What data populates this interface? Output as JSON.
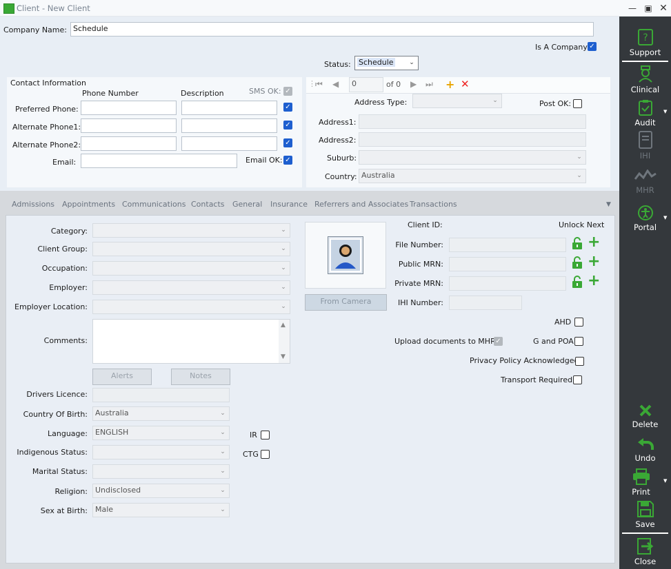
{
  "window": {
    "title": "Client - New Client"
  },
  "header": {
    "company_name_label": "Company Name:",
    "company_name_value": "Schedule",
    "is_company_label": "Is A Company:",
    "status_label": "Status:",
    "status_value": "Schedule"
  },
  "contact": {
    "section_title": "Contact Information",
    "col_phone": "Phone Number",
    "col_description": "Description",
    "sms_ok_label": "SMS OK:",
    "rows": [
      {
        "label": "Preferred Phone:",
        "phone": "",
        "description": ""
      },
      {
        "label": "Alternate Phone1:",
        "phone": "",
        "description": ""
      },
      {
        "label": "Alternate Phone2:",
        "phone": "",
        "description": ""
      }
    ],
    "email_label": "Email:",
    "email_value": "",
    "email_ok_label": "Email OK:"
  },
  "address": {
    "record_value": "0",
    "of_label": "of 0",
    "address_type_label": "Address  Type:",
    "post_ok_label": "Post OK:",
    "address1_label": "Address1:",
    "address2_label": "Address2:",
    "suburb_label": "Suburb:",
    "country_label": "Country:",
    "country_value": "Australia"
  },
  "tabs": [
    "Admissions",
    "Appointments",
    "Communications",
    "Contacts",
    "General",
    "Insurance",
    "Referrers and Associates",
    "Transactions"
  ],
  "general": {
    "category_label": "Category:",
    "client_group_label": "Client Group:",
    "occupation_label": "Occupation:",
    "employer_label": "Employer:",
    "employer_location_label": "Employer Location:",
    "comments_label": "Comments:",
    "alerts_button": "Alerts",
    "notes_button": "Notes",
    "drivers_licence_label": "Drivers Licence:",
    "country_of_birth_label": "Country Of Birth:",
    "country_of_birth_value": "Australia",
    "language_label": "Language:",
    "language_value": "ENGLISH",
    "indigenous_label": "Indigenous Status:",
    "marital_label": "Marital Status:",
    "religion_label": "Religion:",
    "religion_value": "Undisclosed",
    "sex_label": "Sex at Birth:",
    "sex_value": "Male",
    "ir_label": "IR",
    "ctg_label": "CTG",
    "from_camera_button": "From Camera",
    "client_id_label": "Client ID:",
    "unlock_next_label": "Unlock Next",
    "file_number_label": "File Number:",
    "public_mrn_label": "Public MRN:",
    "private_mrn_label": "Private MRN:",
    "ihi_number_label": "IHI Number:",
    "ahd_label": "AHD",
    "upload_mhr_label": "Upload documents to MHR",
    "g_poa_label": "G and POA",
    "privacy_label": "Privacy Policy Acknowledged",
    "transport_label": "Transport Required:"
  },
  "sidebar": {
    "support": "Support",
    "clinical": "Clinical",
    "audit": "Audit",
    "ihi": "IHI",
    "mhr": "MHR",
    "portal": "Portal",
    "delete": "Delete",
    "undo": "Undo",
    "print": "Print",
    "save": "Save",
    "close": "Close"
  }
}
